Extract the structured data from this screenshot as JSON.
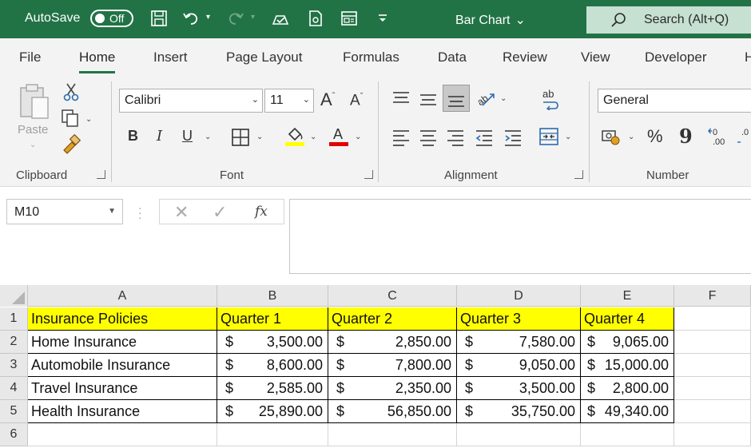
{
  "titlebar": {
    "autosave_label": "AutoSave",
    "autosave_state": "Off",
    "doc_title": "Bar Chart",
    "search_label": "Search (Alt+Q)"
  },
  "tabs": [
    {
      "label": "File"
    },
    {
      "label": "Home"
    },
    {
      "label": "Insert"
    },
    {
      "label": "Page Layout"
    },
    {
      "label": "Formulas"
    },
    {
      "label": "Data"
    },
    {
      "label": "Review"
    },
    {
      "label": "View"
    },
    {
      "label": "Developer"
    },
    {
      "label": "H"
    }
  ],
  "ribbon": {
    "clipboard": {
      "group_label": "Clipboard",
      "paste_label": "Paste"
    },
    "font": {
      "group_label": "Font",
      "font_name": "Calibri",
      "font_size": "11",
      "bold": "B",
      "italic": "I",
      "underline": "U"
    },
    "alignment": {
      "group_label": "Alignment"
    },
    "number": {
      "group_label": "Number",
      "format": "General",
      "percent": "%",
      "comma": "9"
    }
  },
  "formula_bar": {
    "name_box": "M10",
    "fx": "fx",
    "formula": ""
  },
  "grid": {
    "columns": [
      "A",
      "B",
      "C",
      "D",
      "E",
      "F"
    ],
    "rows": [
      "1",
      "2",
      "3",
      "4",
      "5",
      "6"
    ],
    "header": [
      "Insurance Policies",
      "Quarter 1",
      "Quarter 2",
      "Quarter 3",
      "Quarter 4"
    ],
    "currency_symbol": "$",
    "data": [
      {
        "policy": "Home Insurance",
        "q1": "3,500.00",
        "q2": "2,850.00",
        "q3": "7,580.00",
        "q4": "9,065.00"
      },
      {
        "policy": "Automobile Insurance",
        "q1": "8,600.00",
        "q2": "7,800.00",
        "q3": "9,050.00",
        "q4": "15,000.00"
      },
      {
        "policy": "Travel Insurance",
        "q1": "2,585.00",
        "q2": "2,350.00",
        "q3": "3,500.00",
        "q4": "2,800.00"
      },
      {
        "policy": "Health Insurance",
        "q1": "25,890.00",
        "q2": "56,850.00",
        "q3": "35,750.00",
        "q4": "49,340.00"
      }
    ]
  },
  "colors": {
    "excel_green": "#217346",
    "header_fill": "#ffff00",
    "highlight_yellow": "#ffff00",
    "font_red": "#e00000"
  }
}
